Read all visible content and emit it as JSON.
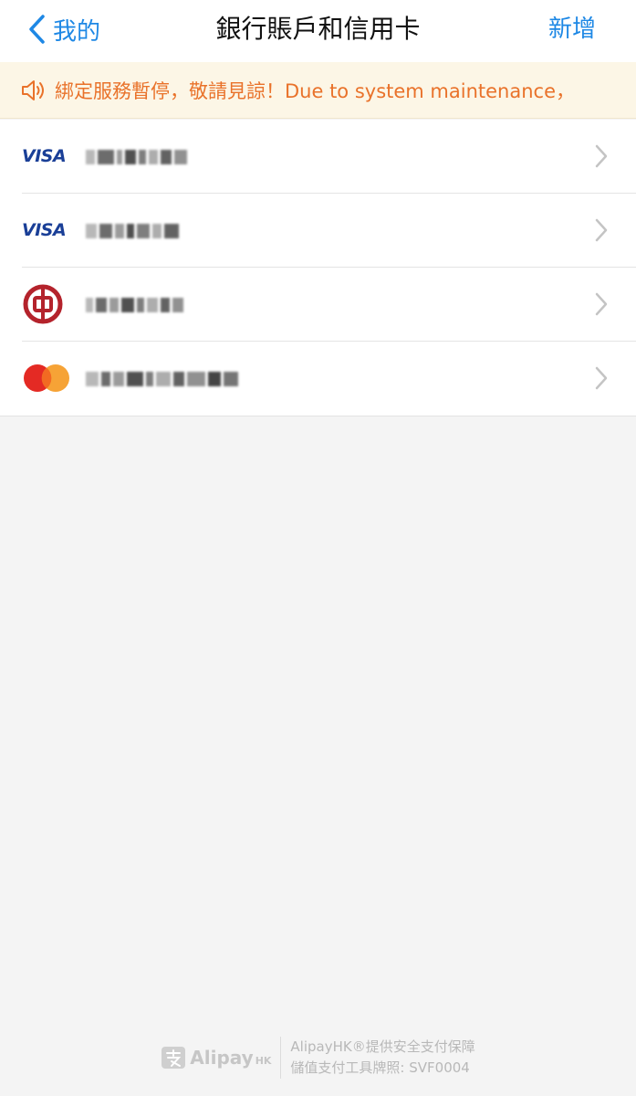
{
  "nav": {
    "back_label": "我的",
    "title": "銀行賬戶和信用卡",
    "add_label": "新增"
  },
  "notice": {
    "text": "綁定服務暫停，敬請見諒！Due to system maintenance，"
  },
  "cards": [
    {
      "brand": "VISA",
      "masked_widths": [
        10,
        18,
        6,
        12,
        8,
        10,
        12,
        14
      ]
    },
    {
      "brand": "VISA",
      "masked_widths": [
        12,
        14,
        10,
        8,
        14,
        10,
        16
      ]
    },
    {
      "brand": "Bank of China",
      "masked_widths": [
        8,
        12,
        10,
        14,
        8,
        12,
        10,
        12
      ]
    },
    {
      "brand": "MasterCard",
      "masked_widths": [
        14,
        10,
        12,
        18,
        8,
        16,
        12,
        20,
        14,
        16
      ]
    }
  ],
  "colors": {
    "accent": "#1e88e5",
    "notice_text": "#e9722a",
    "notice_bg": "#fcf6e6",
    "visa_blue": "#1a3f97",
    "boc_red": "#b4232c"
  },
  "footer": {
    "brand": "Alipay",
    "brand_suffix": "HK",
    "line1": "AlipayHK®提供安全支付保障",
    "line2": "儲值支付工具牌照: SVF0004"
  }
}
